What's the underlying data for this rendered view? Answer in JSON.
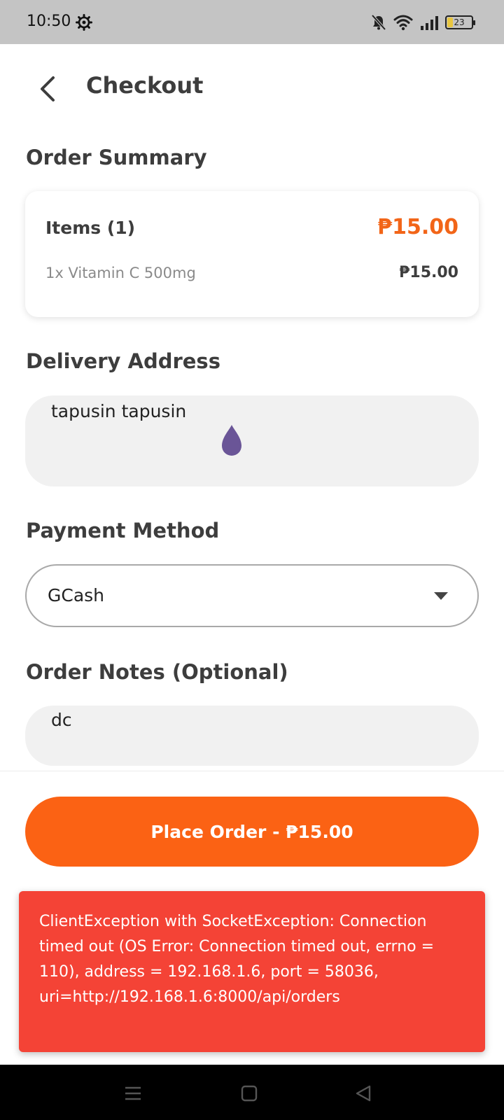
{
  "status_bar": {
    "time": "10:50",
    "battery": "23",
    "icons": [
      "gear-icon",
      "bell-off-icon",
      "wifi-icon",
      "signal-icon",
      "battery-icon"
    ]
  },
  "header": {
    "title": "Checkout",
    "back_icon": "chevron-left-icon"
  },
  "order_summary": {
    "title": "Order Summary",
    "items_label": "Items (1)",
    "items_total": "₱15.00",
    "lines": [
      {
        "name": "1x Vitamin C 500mg",
        "price": "₱15.00"
      }
    ]
  },
  "delivery": {
    "title": "Delivery Address",
    "value": "tapusin tapusin"
  },
  "payment": {
    "title": "Payment Method",
    "selected": "GCash"
  },
  "notes": {
    "title": "Order Notes (Optional)",
    "value": "dc"
  },
  "actions": {
    "place_order": "Place Order - ₱15.00"
  },
  "error": {
    "message": "ClientException with SocketException: Connection timed out (OS Error: Connection timed out, errno = 110), address = 192.168.1.6, port = 58036, uri=http://192.168.1.6:8000/api/orders"
  },
  "colors": {
    "accent": "#fb6214",
    "price": "#f26518",
    "error": "#f44336",
    "cursor": "#6a5597"
  },
  "nav_bar": {
    "icons": [
      "menu-icon",
      "home-square-icon",
      "back-triangle-icon"
    ]
  }
}
